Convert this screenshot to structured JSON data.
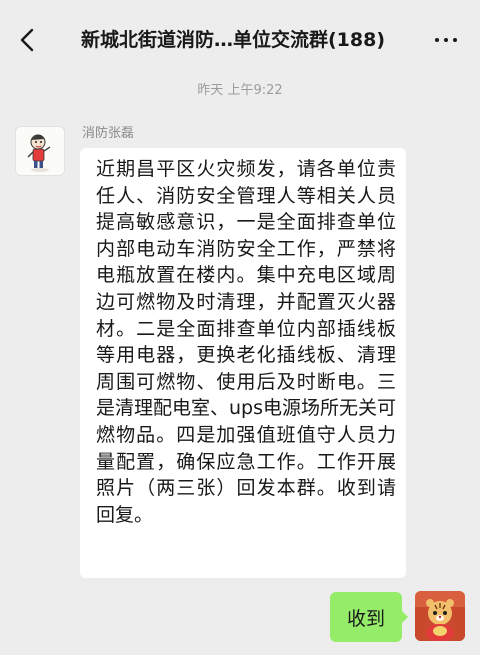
{
  "header": {
    "title": "新城北街道消防…单位交流群(188)",
    "back_icon": "chevron-left-icon",
    "more_icon": "more-dots-icon"
  },
  "chat": {
    "timestamp": "昨天 上午9:22",
    "messages": [
      {
        "sender": "消防张磊",
        "direction": "incoming",
        "text": "近期昌平区火灾频发，请各单位责任人、消防安全管理人等相关人员提高敏感意识，一是全面排查单位内部电动车消防安全工作，严禁将电瓶放置在楼内。集中充电区域周边可燃物及时清理，并配置灭火器材。二是全面排查单位内部插线板等用电器，更换老化插线板、清理周围可燃物、使用后及时断电。三是清理配电室、ups电源场所无关可燃物品。四是加强值班值守人员力量配置，确保应急工作。工作开展照片（两三张）回发本群。收到请回复。"
      },
      {
        "direction": "outgoing",
        "text": "收到"
      }
    ]
  },
  "colors": {
    "background": "#ededed",
    "incoming_bubble": "#ffffff",
    "outgoing_bubble": "#95ec69",
    "timestamp": "#9c9c9c"
  }
}
